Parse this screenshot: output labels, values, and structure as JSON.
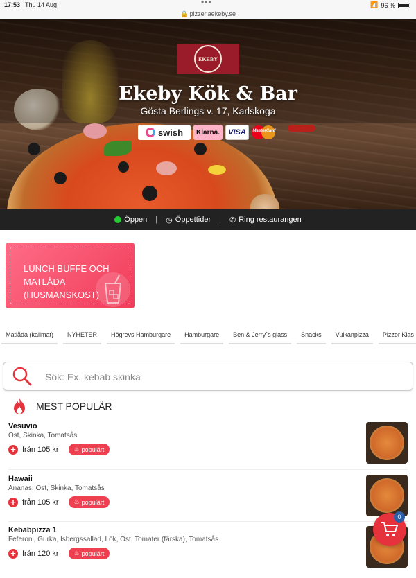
{
  "statusbar": {
    "time": "17:53",
    "date": "Thu 14 Aug",
    "url": "pizzeriaekeby.se",
    "battery": "96 %"
  },
  "header": {
    "logo_text": "EKEBY",
    "name": "Ekeby Kök & Bar",
    "address": "Gösta Berlings v. 17, Karlskoga",
    "payments": [
      "swish",
      "Klarna.",
      "VISA",
      "MasterCard"
    ]
  },
  "infobar": {
    "open": "Öppen",
    "hours": "Öppettider",
    "call": "Ring restaurangen"
  },
  "promo": {
    "label": "LUNCH BUFFE OCH MATLÅDA (HUSMANSKOST)"
  },
  "categories": [
    "Matlåda (kallmat)",
    "NYHETER",
    "Högrevs Hamburgare",
    "Hamburgare",
    "Ben & Jerry´s glass",
    "Snacks",
    "Vulkanpizza",
    "Pizzor Klas"
  ],
  "search": {
    "placeholder": "Sök: Ex. kebab skinka"
  },
  "section": {
    "title": "MEST POPULÄR"
  },
  "items": [
    {
      "name": "Vesuvio",
      "desc": "Ost, Skinka, Tomatsås",
      "price": "från 105 kr",
      "badge": "populärt"
    },
    {
      "name": "Hawaii",
      "desc": "Ananas, Ost, Skinka, Tomatsås",
      "price": "från 105 kr",
      "badge": "populärt"
    },
    {
      "name": "Kebabpizza 1",
      "desc": "Feferoni, Gurka, Isbergssallad, Lök, Ost, Tomater (färska), Tomatsås",
      "price": "från 120 kr",
      "badge": "populärt"
    }
  ],
  "cart": {
    "count": "0"
  },
  "colors": {
    "accent": "#e6323c",
    "open": "#22cc33",
    "promo": "#f03d5a"
  }
}
